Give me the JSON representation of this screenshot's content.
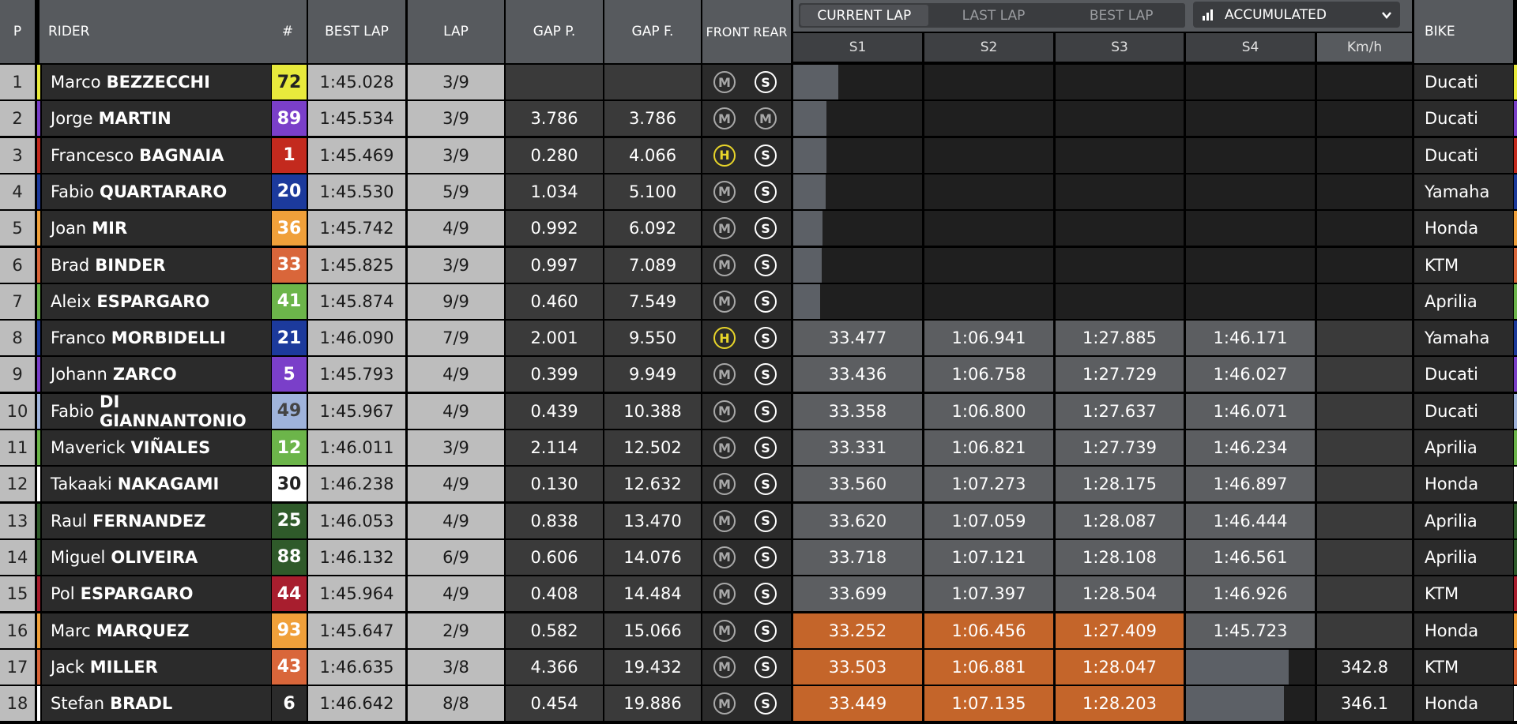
{
  "columns": {
    "pos": "P",
    "rider": "RIDER",
    "num": "#",
    "best_lap": "BEST LAP",
    "lap": "LAP",
    "gap_p": "GAP P.",
    "gap_f": "GAP F.",
    "tyres": "FRONT REAR",
    "bike": "BIKE",
    "s1": "S1",
    "s2": "S2",
    "s3": "S3",
    "s4": "S4",
    "kmh": "Km/h"
  },
  "tabs": [
    "CURRENT LAP",
    "LAST LAP",
    "BEST LAP"
  ],
  "active_tab": 0,
  "dropdown": {
    "icon": "bar-chart-icon",
    "label": "ACCUMULATED"
  },
  "colors": {
    "orange_sector": "#c4652a",
    "sector_grey": "#5c5e61",
    "sector_dark": "#1f1f1f"
  },
  "rows": [
    {
      "pos": "1",
      "first": "Marco",
      "last": "BEZZECCHI",
      "num": "72",
      "num_bg": "#e8ea3c",
      "num_fg": "#222",
      "best": "1:45.028",
      "lap": "3/9",
      "gap_p": "",
      "gap_f": "",
      "front": "M",
      "rear": "S",
      "s1": "",
      "s2": "",
      "s3": "",
      "s4": "",
      "kmh": "",
      "progress": 0.35,
      "bike": "Ducati",
      "team": "#e8ea3c",
      "sector_style": "empty"
    },
    {
      "pos": "2",
      "first": "Jorge",
      "last": "MARTIN",
      "num": "89",
      "num_bg": "#7a3fc9",
      "num_fg": "#fff",
      "best": "1:45.534",
      "lap": "3/9",
      "gap_p": "3.786",
      "gap_f": "3.786",
      "front": "M",
      "rear": "M",
      "s1": "",
      "s2": "",
      "s3": "",
      "s4": "",
      "kmh": "",
      "progress": 0.26,
      "bike": "Ducati",
      "team": "#7a3fc9",
      "sector_style": "empty"
    },
    {
      "pos": "3",
      "first": "Francesco",
      "last": "BAGNAIA",
      "num": "1",
      "num_bg": "#c32a1e",
      "num_fg": "#fff",
      "best": "1:45.469",
      "lap": "3/9",
      "gap_p": "0.280",
      "gap_f": "4.066",
      "front": "H",
      "rear": "S",
      "s1": "",
      "s2": "",
      "s3": "",
      "s4": "",
      "kmh": "",
      "progress": 0.26,
      "bike": "Ducati",
      "team": "#c32a1e",
      "sector_style": "empty"
    },
    {
      "pos": "4",
      "first": "Fabio",
      "last": "QUARTARARO",
      "num": "20",
      "num_bg": "#1c3a9c",
      "num_fg": "#fff",
      "best": "1:45.530",
      "lap": "5/9",
      "gap_p": "1.034",
      "gap_f": "5.100",
      "front": "M",
      "rear": "S",
      "s1": "",
      "s2": "",
      "s3": "",
      "s4": "",
      "kmh": "",
      "progress": 0.25,
      "bike": "Yamaha",
      "team": "#1c3a9c",
      "sector_style": "empty"
    },
    {
      "pos": "5",
      "first": "Joan",
      "last": "MIR",
      "num": "36",
      "num_bg": "#f0a03a",
      "num_fg": "#fff",
      "best": "1:45.742",
      "lap": "4/9",
      "gap_p": "0.992",
      "gap_f": "6.092",
      "front": "M",
      "rear": "S",
      "s1": "",
      "s2": "",
      "s3": "",
      "s4": "",
      "kmh": "",
      "progress": 0.23,
      "bike": "Honda",
      "team": "#f0a03a",
      "sector_style": "empty"
    },
    {
      "pos": "6",
      "first": "Brad",
      "last": "BINDER",
      "num": "33",
      "num_bg": "#d9663a",
      "num_fg": "#fff",
      "best": "1:45.825",
      "lap": "3/9",
      "gap_p": "0.997",
      "gap_f": "7.089",
      "front": "M",
      "rear": "S",
      "s1": "",
      "s2": "",
      "s3": "",
      "s4": "",
      "kmh": "",
      "progress": 0.22,
      "bike": "KTM",
      "team": "#d9663a",
      "sector_style": "empty"
    },
    {
      "pos": "7",
      "first": "Aleix",
      "last": "ESPARGARO",
      "num": "41",
      "num_bg": "#6cb54a",
      "num_fg": "#fff",
      "best": "1:45.874",
      "lap": "9/9",
      "gap_p": "0.460",
      "gap_f": "7.549",
      "front": "M",
      "rear": "S",
      "s1": "",
      "s2": "",
      "s3": "",
      "s4": "",
      "kmh": "",
      "progress": 0.21,
      "bike": "Aprilia",
      "team": "#6cb54a",
      "sector_style": "empty"
    },
    {
      "pos": "8",
      "first": "Franco",
      "last": "MORBIDELLI",
      "num": "21",
      "num_bg": "#1c3a9c",
      "num_fg": "#fff",
      "best": "1:46.090",
      "lap": "7/9",
      "gap_p": "2.001",
      "gap_f": "9.550",
      "front": "H",
      "rear": "S",
      "s1": "33.477",
      "s2": "1:06.941",
      "s3": "1:27.885",
      "s4": "1:46.171",
      "kmh": "",
      "progress": 0,
      "bike": "Yamaha",
      "team": "#1c3a9c",
      "sector_style": "grey"
    },
    {
      "pos": "9",
      "first": "Johann",
      "last": "ZARCO",
      "num": "5",
      "num_bg": "#7a3fc9",
      "num_fg": "#fff",
      "best": "1:45.793",
      "lap": "4/9",
      "gap_p": "0.399",
      "gap_f": "9.949",
      "front": "M",
      "rear": "S",
      "s1": "33.436",
      "s2": "1:06.758",
      "s3": "1:27.729",
      "s4": "1:46.027",
      "kmh": "",
      "progress": 0,
      "bike": "Ducati",
      "team": "#7a3fc9",
      "sector_style": "grey"
    },
    {
      "pos": "10",
      "first": "Fabio",
      "last": "DI GIANNANTONIO",
      "num": "49",
      "num_bg": "#9fb3db",
      "num_fg": "#444",
      "best": "1:45.967",
      "lap": "4/9",
      "gap_p": "0.439",
      "gap_f": "10.388",
      "front": "M",
      "rear": "S",
      "s1": "33.358",
      "s2": "1:06.800",
      "s3": "1:27.637",
      "s4": "1:46.071",
      "kmh": "",
      "progress": 0,
      "bike": "Ducati",
      "team": "#9fb3db",
      "sector_style": "grey"
    },
    {
      "pos": "11",
      "first": "Maverick",
      "last": "VIÑALES",
      "num": "12",
      "num_bg": "#6cb54a",
      "num_fg": "#fff",
      "best": "1:46.011",
      "lap": "3/9",
      "gap_p": "2.114",
      "gap_f": "12.502",
      "front": "M",
      "rear": "S",
      "s1": "33.331",
      "s2": "1:06.821",
      "s3": "1:27.739",
      "s4": "1:46.234",
      "kmh": "",
      "progress": 0,
      "bike": "Aprilia",
      "team": "#6cb54a",
      "sector_style": "grey"
    },
    {
      "pos": "12",
      "first": "Takaaki",
      "last": "NAKAGAMI",
      "num": "30",
      "num_bg": "#ffffff",
      "num_fg": "#222",
      "best": "1:46.238",
      "lap": "4/9",
      "gap_p": "0.130",
      "gap_f": "12.632",
      "front": "M",
      "rear": "S",
      "s1": "33.560",
      "s2": "1:07.273",
      "s3": "1:28.175",
      "s4": "1:46.897",
      "kmh": "",
      "progress": 0,
      "bike": "Honda",
      "team": "#ffffff",
      "sector_style": "grey"
    },
    {
      "pos": "13",
      "first": "Raul",
      "last": "FERNANDEZ",
      "num": "25",
      "num_bg": "#2f5a2a",
      "num_fg": "#fff",
      "best": "1:46.053",
      "lap": "4/9",
      "gap_p": "0.838",
      "gap_f": "13.470",
      "front": "M",
      "rear": "S",
      "s1": "33.620",
      "s2": "1:07.059",
      "s3": "1:28.087",
      "s4": "1:46.444",
      "kmh": "",
      "progress": 0,
      "bike": "Aprilia",
      "team": "#2f5a2a",
      "sector_style": "grey"
    },
    {
      "pos": "14",
      "first": "Miguel",
      "last": "OLIVEIRA",
      "num": "88",
      "num_bg": "#2f5a2a",
      "num_fg": "#fff",
      "best": "1:46.132",
      "lap": "6/9",
      "gap_p": "0.606",
      "gap_f": "14.076",
      "front": "M",
      "rear": "S",
      "s1": "33.718",
      "s2": "1:07.121",
      "s3": "1:28.108",
      "s4": "1:46.561",
      "kmh": "",
      "progress": 0,
      "bike": "Aprilia",
      "team": "#2f5a2a",
      "sector_style": "grey"
    },
    {
      "pos": "15",
      "first": "Pol",
      "last": "ESPARGARO",
      "num": "44",
      "num_bg": "#a81e2e",
      "num_fg": "#fff",
      "best": "1:45.964",
      "lap": "4/9",
      "gap_p": "0.408",
      "gap_f": "14.484",
      "front": "M",
      "rear": "S",
      "s1": "33.699",
      "s2": "1:07.397",
      "s3": "1:28.504",
      "s4": "1:46.926",
      "kmh": "",
      "progress": 0,
      "bike": "KTM",
      "team": "#a81e2e",
      "sector_style": "grey"
    },
    {
      "pos": "16",
      "first": "Marc",
      "last": "MARQUEZ",
      "num": "93",
      "num_bg": "#f0a03a",
      "num_fg": "#fff",
      "best": "1:45.647",
      "lap": "2/9",
      "gap_p": "0.582",
      "gap_f": "15.066",
      "front": "M",
      "rear": "S",
      "s1": "33.252",
      "s2": "1:06.456",
      "s3": "1:27.409",
      "s4": "1:45.723",
      "kmh": "",
      "progress": 0,
      "bike": "Honda",
      "team": "#f0a03a",
      "sector_style": "orange"
    },
    {
      "pos": "17",
      "first": "Jack",
      "last": "MILLER",
      "num": "43",
      "num_bg": "#d9663a",
      "num_fg": "#fff",
      "best": "1:46.635",
      "lap": "3/8",
      "gap_p": "4.366",
      "gap_f": "19.432",
      "front": "M",
      "rear": "S",
      "s1": "33.503",
      "s2": "1:06.881",
      "s3": "1:28.047",
      "s4": "",
      "kmh": "342.8",
      "progress": 0.8,
      "bike": "KTM",
      "team": "#d9663a",
      "sector_style": "orange3"
    },
    {
      "pos": "18",
      "first": "Stefan",
      "last": "BRADL",
      "num": "6",
      "num_bg": "#2b2b2b",
      "num_fg": "#fff",
      "best": "1:46.642",
      "lap": "8/8",
      "gap_p": "0.454",
      "gap_f": "19.886",
      "front": "M",
      "rear": "S",
      "s1": "33.449",
      "s2": "1:07.135",
      "s3": "1:28.203",
      "s4": "",
      "kmh": "346.1",
      "progress": 0.76,
      "bike": "Honda",
      "team": "#ffffff",
      "sector_style": "orange3"
    }
  ]
}
